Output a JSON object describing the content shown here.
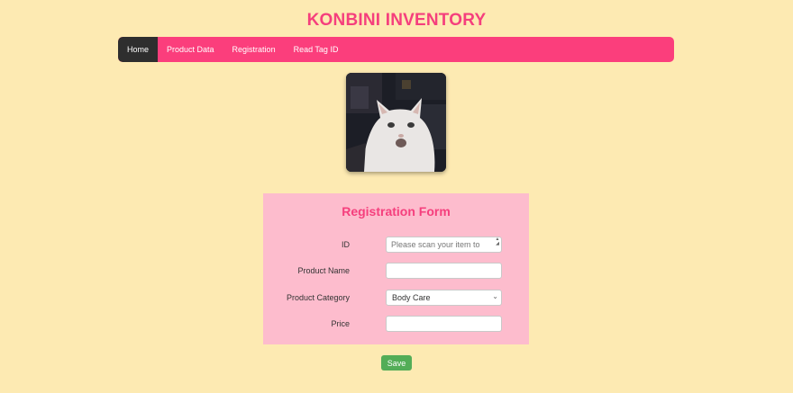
{
  "app": {
    "title": "KONBINI INVENTORY"
  },
  "nav": {
    "items": [
      {
        "label": "Home",
        "active": true
      },
      {
        "label": "Product Data",
        "active": false
      },
      {
        "label": "Registration",
        "active": false
      },
      {
        "label": "Read Tag ID",
        "active": false
      }
    ]
  },
  "form": {
    "title": "Registration Form",
    "id_label": "ID",
    "id_placeholder": "Please scan your item to",
    "name_label": "Product Name",
    "name_value": "",
    "category_label": "Product Category",
    "category_value": "Body Care",
    "price_label": "Price",
    "price_value": "",
    "save_label": "Save"
  },
  "colors": {
    "background": "#fdeab2",
    "accent": "#f53f7d",
    "nav_active": "#2e2e2e",
    "form_bg": "#fdbccd",
    "save_button": "#53ad57"
  }
}
